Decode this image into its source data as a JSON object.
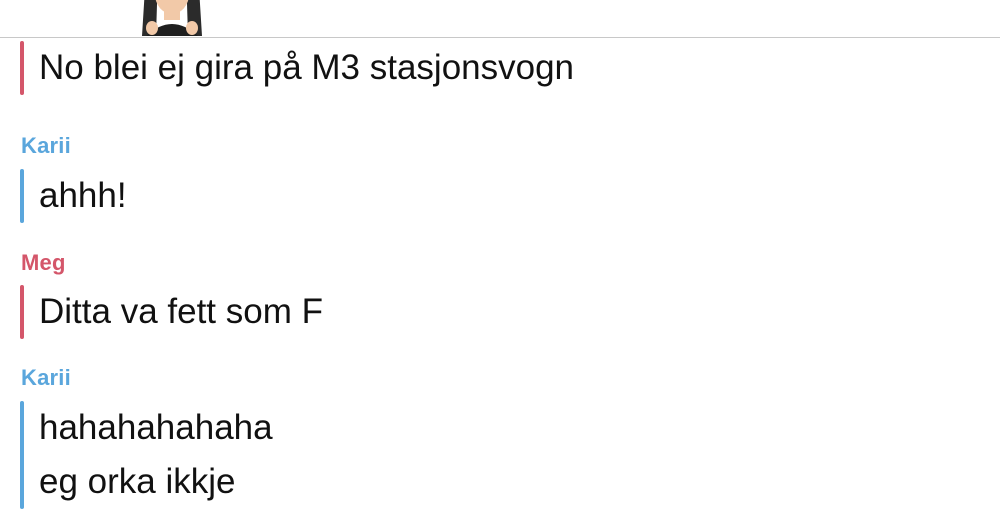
{
  "colors": {
    "karii": "#5aa6dc",
    "meg": "#d4566a",
    "text": "#111111",
    "divider": "#c8c8c8"
  },
  "header": {
    "avatar_icon": "bitmoji-avatar-icon"
  },
  "messages": [
    {
      "sender": "",
      "lines": [
        "No blei ej gira på M3 stasjonsvogn"
      ]
    },
    {
      "sender": "Karii",
      "lines": [
        "ahhh!"
      ]
    },
    {
      "sender": "Meg",
      "lines": [
        "Ditta va fett som F"
      ]
    },
    {
      "sender": "Karii",
      "lines": [
        "hahahahahaha",
        "eg orka ikkje"
      ]
    }
  ]
}
